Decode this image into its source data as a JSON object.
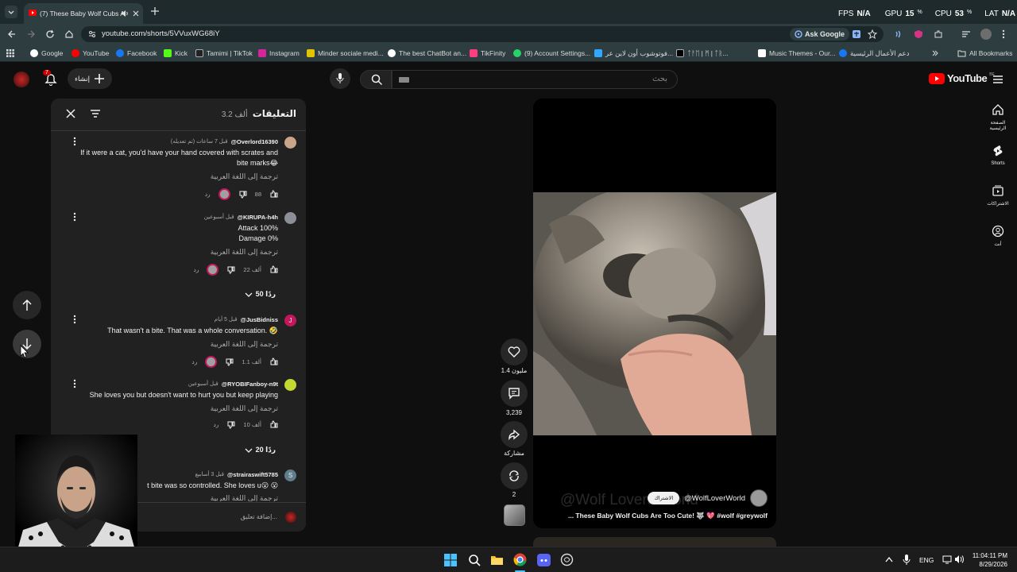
{
  "browser": {
    "tab_title": "(7) These Baby Wolf Cubs A",
    "url": "youtube.com/shorts/5VVuxWG68iY",
    "ask_google": "Ask Google",
    "stats": {
      "fps_label": "FPS",
      "fps": "N/A",
      "gpu_label": "GPU",
      "gpu": "15",
      "cpu_label": "CPU",
      "cpu": "53",
      "lat_label": "LAT",
      "lat": "N/A",
      "pct": "%"
    },
    "bookmarks": [
      "Google",
      "YouTube",
      "Facebook",
      "Kick",
      "Tamimi | TikTok",
      "Instagram",
      "Minder sociale medi...",
      "The best ChatBot an...",
      "TikFinity",
      "(9) Account Settings...",
      "فوتوشوب أون لاين عر...",
      "ᛏᚨᛖ | ᛗ | ᛏᚱ...",
      "Music Themes - Our...",
      "دعم الأعمال الرئيسية"
    ],
    "all_bookmarks": "All Bookmarks"
  },
  "youtube": {
    "create_label": "إنشاء",
    "notif_count": "7",
    "search_placeholder": "بحث",
    "logo_text": "YouTube",
    "logo_region": "BE",
    "nav": [
      {
        "label": "الصفحة الرئيسية",
        "icon": "home-icon"
      },
      {
        "label": "Shorts",
        "icon": "shorts-icon"
      },
      {
        "label": "الاشتراكات",
        "icon": "subscriptions-icon"
      },
      {
        "label": "أنت",
        "icon": "you-icon"
      }
    ]
  },
  "comments_panel": {
    "title": "التعليقات",
    "count": "3.2 ألف",
    "add_placeholder": "إضافة تعليق...",
    "translate": "ترجمة إلى اللغة العربية",
    "reply": "رد",
    "comments": [
      {
        "user": "@Overlord16390",
        "time": "قبل 7 ساعات (تم تعديله)",
        "text_lines": [
          "If it were a cat, you'd have your hand covered with scrates and",
          "bite marks😂"
        ],
        "likes": "88",
        "avatar_color": "#c9a38a"
      },
      {
        "user": "@KIRUPA-h4h",
        "time": "قبل أسبوعين",
        "text_lines": [
          "Attack 100%",
          "Damage 0%"
        ],
        "likes": "22 ألف",
        "avatar_color": "#8c8f96",
        "replies": "50 ردًا"
      },
      {
        "user": "@JusBidniss",
        "time": "قبل 5 أيام",
        "text_lines": [
          "That wasn't a bite.  That was a whole conversation.  🤣"
        ],
        "likes": "1.1 ألف",
        "avatar_color": "#c2185b",
        "avatar_letter": "J"
      },
      {
        "user": "@RYOBIFanboy-n9t",
        "time": "قبل أسبوعين",
        "text_lines": [
          "She loves you but doesn't want to hurt you but keep playing"
        ],
        "likes": "10 ألف",
        "avatar_color": "#c5d832",
        "replies": "20 ردًا"
      },
      {
        "user": "@strairaswift5785",
        "time": "قبل 3 أسابيع",
        "text_lines": [
          "t bite was so controlled. She loves u😮 😮"
        ],
        "avatar_color": "#607d8b",
        "avatar_letter": "S"
      }
    ]
  },
  "short": {
    "likes": "1.4 مليون",
    "comments": "3,239",
    "share": "مشاركة",
    "remix": "2",
    "channel": "@WolfLoverWorld",
    "subscribe": "الاشتراك",
    "title": "... These Baby Wolf Cubs Are Too Cute! 🐺 💖 #wolf #greywolf",
    "watermark": "@Wolf Lovers World"
  },
  "taskbar": {
    "lang": "ENG",
    "time": "11:04:11 PM",
    "date": "8/29/2026"
  },
  "colors": {
    "accent_red": "#ff0000",
    "chrome_bg": "#1e2a2c"
  }
}
